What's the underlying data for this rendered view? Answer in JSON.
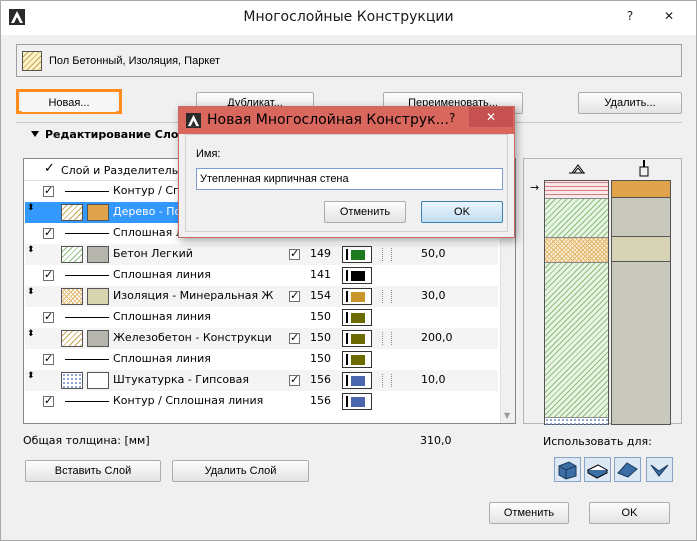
{
  "window": {
    "title": "Многослойные Конструкции",
    "help_label": "?",
    "close_label": "✕"
  },
  "current": {
    "name": "Пол Бетонный, Изоляция, Паркет"
  },
  "toolbar": {
    "new_label": "Новая...",
    "duplicate_label": "Дубликат...",
    "rename_label": "Переименовать...",
    "delete_label": "Удалить..."
  },
  "section": {
    "title": "Редактирование Слое"
  },
  "table": {
    "header_label": "Слой и Разделитель",
    "rows": [
      {
        "kind": "line",
        "label": "Контур / Спл",
        "pen": "",
        "thickness": "",
        "pen_color": ""
      },
      {
        "kind": "layer",
        "label": "Дерево - Пол",
        "pen": "",
        "thickness": "",
        "pen_color": ""
      },
      {
        "kind": "line",
        "label": "Сплошная линия",
        "pen": "",
        "thickness": "",
        "pen_color": ""
      },
      {
        "kind": "layer",
        "label": "Бетон Легкий",
        "pen": "149",
        "thickness": "50,0",
        "pen_color": "#1e7a1e"
      },
      {
        "kind": "line",
        "label": "Сплошная линия",
        "pen": "141",
        "thickness": "",
        "pen_color": "#000000"
      },
      {
        "kind": "layer",
        "label": "Изоляция - Минеральная Ж...",
        "pen": "154",
        "thickness": "30,0",
        "pen_color": "#c8962a"
      },
      {
        "kind": "line",
        "label": "Сплошная линия",
        "pen": "150",
        "thickness": "",
        "pen_color": "#6b6b00"
      },
      {
        "kind": "layer",
        "label": "Железобетон - Конструкци...",
        "pen": "150",
        "thickness": "200,0",
        "pen_color": "#6b6b00"
      },
      {
        "kind": "line",
        "label": "Сплошная линия",
        "pen": "150",
        "thickness": "",
        "pen_color": "#6b6b00"
      },
      {
        "kind": "layer",
        "label": "Штукатурка - Гипсовая",
        "pen": "156",
        "thickness": "10,0",
        "pen_color": "#4a66b0"
      },
      {
        "kind": "line",
        "label": "Контур / Сплошная линия",
        "pen": "156",
        "thickness": "",
        "pen_color": "#4a66b0"
      }
    ]
  },
  "total": {
    "label": "Общая толщина: [мм]",
    "value": "310,0"
  },
  "bottom": {
    "insert_label": "Вставить Слой",
    "remove_label": "Удалить Слой",
    "use_for_label": "Использовать для:",
    "cancel_label": "Отменить",
    "ok_label": "OK"
  },
  "dialog": {
    "title": "Новая Многослойная Конструк...",
    "help_label": "?",
    "close_label": "✕",
    "name_label": "Имя:",
    "name_value": "Утепленная кирпичная стена",
    "cancel_label": "Отменить",
    "ok_label": "OK"
  },
  "colors": {
    "accent_highlight": "#ff8c1a",
    "selection": "#3399ff",
    "dialog_titlebar": "#d9675e",
    "close_button": "#c75050"
  },
  "icons": [
    "app-icon",
    "help-icon",
    "close-icon",
    "wall-icon",
    "slab-icon",
    "roof-icon",
    "shell-icon",
    "cut-icon",
    "pen-icon"
  ]
}
